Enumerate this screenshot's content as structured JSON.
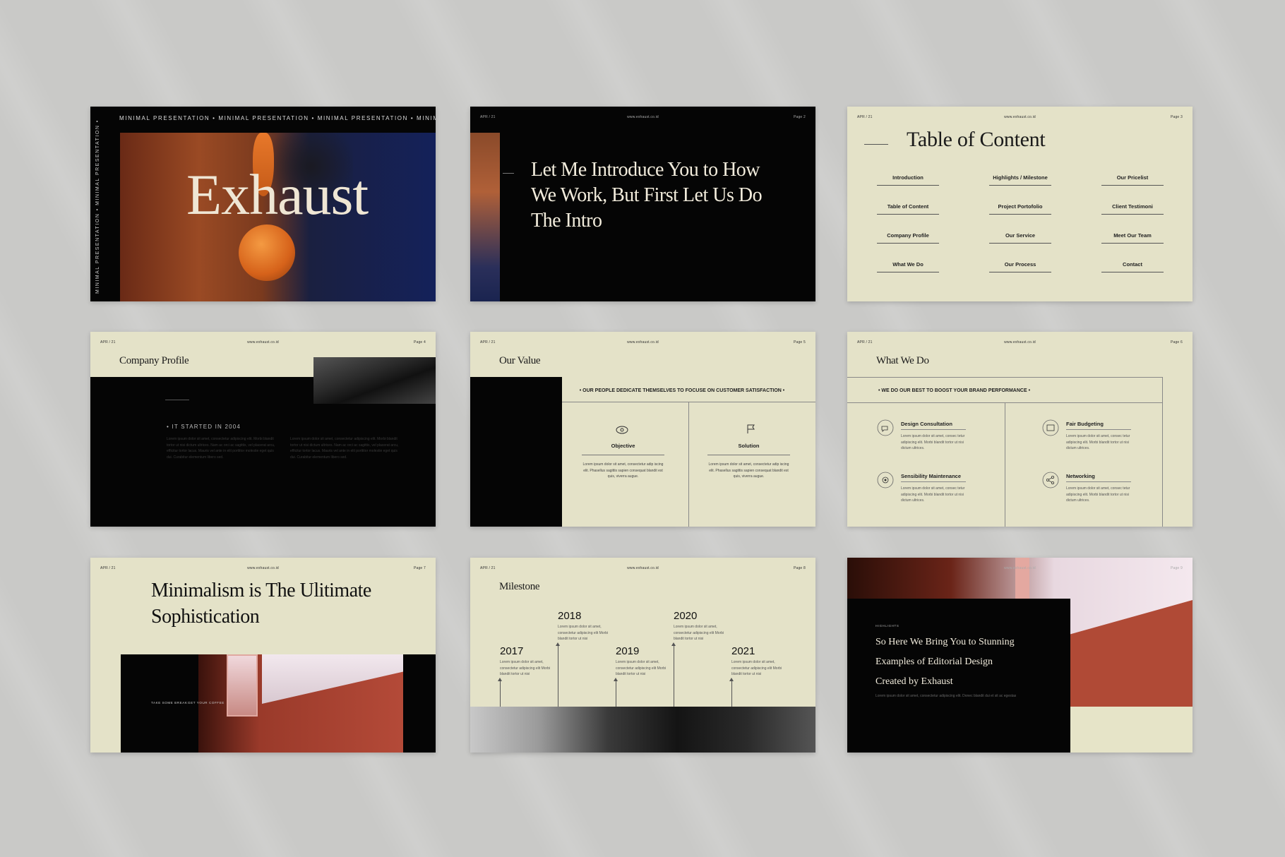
{
  "slide1": {
    "marquee": "MINIMAL PRESENTATION • MINIMAL PRESENTATION • MINIMAL PRESENTATION • MINIMAL PRESE",
    "vertical": "MINIMAL PRESENTATION • MINIMAL PRESENTATION •",
    "title": "Exhaust"
  },
  "slide2": {
    "date": "APR / 21",
    "site": "www.exhaust.co.id",
    "page": "Page 2",
    "headline": "Let Me Introduce You to How We Work, But First Let Us Do The Intro"
  },
  "slide3": {
    "date": "APR / 21",
    "site": "www.exhaust.co.id",
    "page": "Page 3",
    "title": "Table of Content",
    "items": [
      "Introduction",
      "Highlights / Milestone",
      "Our Pricelist",
      "Table of Content",
      "Project Portofolio",
      "Client Testimoni",
      "Company Profile",
      "Our Service",
      "Meet Our Team",
      "What We Do",
      "Our Process",
      "Contact"
    ]
  },
  "slide4": {
    "date": "APR / 21",
    "site": "www.exhaust.co.id",
    "page": "Page 4",
    "title": "Company Profile",
    "started": "• IT STARTED IN 2004"
  },
  "slide5": {
    "date": "APR / 21",
    "site": "www.exhaust.co.id",
    "page": "Page 5",
    "title": "Our Value",
    "banner": "• OUR PEOPLE DEDICATE THEMSELVES TO FOCUSE ON CUSTOMER SATISFACTION •",
    "col1_title": "Objective",
    "col2_title": "Solution",
    "body": "Lorem ipsum dolor sit amet, consectetur adip iscing elit. Phasellus sagittis sapien consequat blandit est quis, viverra augue."
  },
  "slide6": {
    "date": "APR / 21",
    "site": "www.exhaust.co.id",
    "page": "Page 6",
    "title": "What We Do",
    "banner": "• WE DO OUR BEST TO BOOST YOUR BRAND PERFORMANCE •",
    "services": [
      {
        "name": "Design Consultation",
        "icon": "chat-icon"
      },
      {
        "name": "Fair Budgeting",
        "icon": "wallet-icon"
      },
      {
        "name": "Sensibility Maintenance",
        "icon": "gear-icon"
      },
      {
        "name": "Networking",
        "icon": "share-icon"
      }
    ],
    "body": "Lorem ipsum dolor sit amet, consec tetur adipiscing elit. Morbi blandit tortor ut nisi dictum ultrices."
  },
  "slide7": {
    "date": "APR / 21",
    "site": "www.exhaust.co.id",
    "page": "Page 7",
    "headline": "Minimalism is The Ulitimate Sophistication",
    "caption1": "TAKE SOME BREAK",
    "caption2": "GET YOUR COFFEE"
  },
  "slide8": {
    "date": "APR / 21",
    "site": "www.exhaust.co.id",
    "page": "Page 8",
    "title": "Milestone",
    "years": [
      "2017",
      "2018",
      "2019",
      "2020",
      "2021"
    ],
    "body": "Lorem ipsum dolor sit amet, consectetur adipiscing elit Morbi blandit tortor ut nisi"
  },
  "slide9": {
    "site": "www.exhaust.co.id",
    "page": "Page 9",
    "label": "HIGHLIGHTS",
    "headline": "So Here We Bring You to Stunning Examples of Editorial Design Created by Exhaust",
    "body": "Lorem ipsum dolor sit amet, consectetur adipiscing elit. Donec blandit dui et sit ac egestas"
  },
  "lorem_long": "Lorem ipsum dolor sit amet, consectetur adipiscing elit. Morbi blandit tortor ut nisi dictum ultrices. Nam ac orci ac sagittis, vel placerat arcu, efficitur tortor lacus. Mauris vel ante in elit porttitor molestie eget quis dui. Curabitur elementum libero sed."
}
